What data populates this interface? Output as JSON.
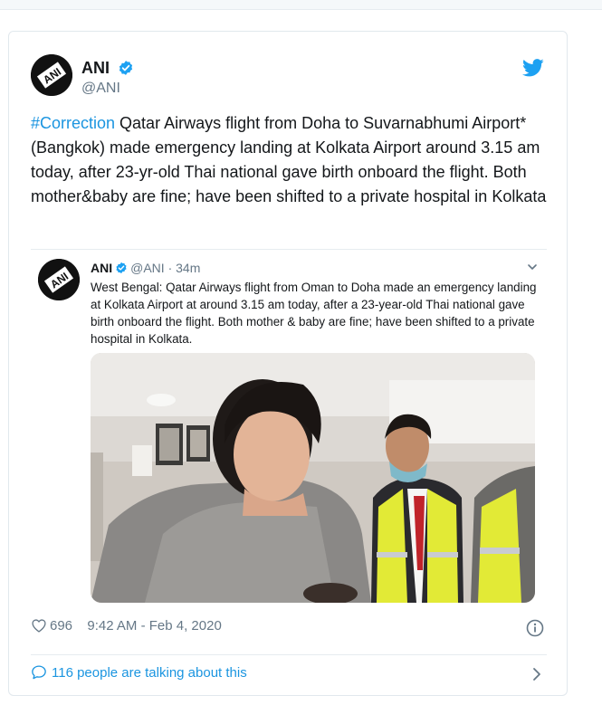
{
  "tweet": {
    "author_name": "ANI",
    "author_handle": "@ANI",
    "avatar_logo_text": "ANI",
    "text_hashtag": "#Correction",
    "text_body": " Qatar Airways flight from Doha to Suvarnabhumi Airport* (Bangkok) made emergency landing at Kolkata Airport around 3.15 am today, after 23-yr-old Thai national gave birth onboard the flight. Both mother&baby are fine; have been shifted to a private hospital in Kolkata",
    "likes": "696",
    "timestamp": "9:42 AM - Feb 4, 2020",
    "footer_link": "116 people are talking about this"
  },
  "quoted": {
    "author_name": "ANI",
    "author_handle": "@ANI",
    "separator": " · ",
    "age": "34m",
    "text": "West Bengal: Qatar Airways flight from Oman to Doha made an emergency landing at Kolkata Airport at around 3.15 am today, after a 23-year-old Thai national gave birth onboard the flight. Both mother & baby are fine; have been shifted to a private hospital in Kolkata."
  },
  "icons": {
    "verified": "verified-badge-icon",
    "brand": "twitter-bird-icon",
    "like": "heart-icon",
    "info": "info-icon",
    "reply": "speech-bubble-icon",
    "more": "chevron-down-icon",
    "go": "chevron-right-icon"
  },
  "colors": {
    "accent": "#1b95e0",
    "text": "#14171a",
    "muted": "#657786",
    "border": "#e1e8ed"
  }
}
